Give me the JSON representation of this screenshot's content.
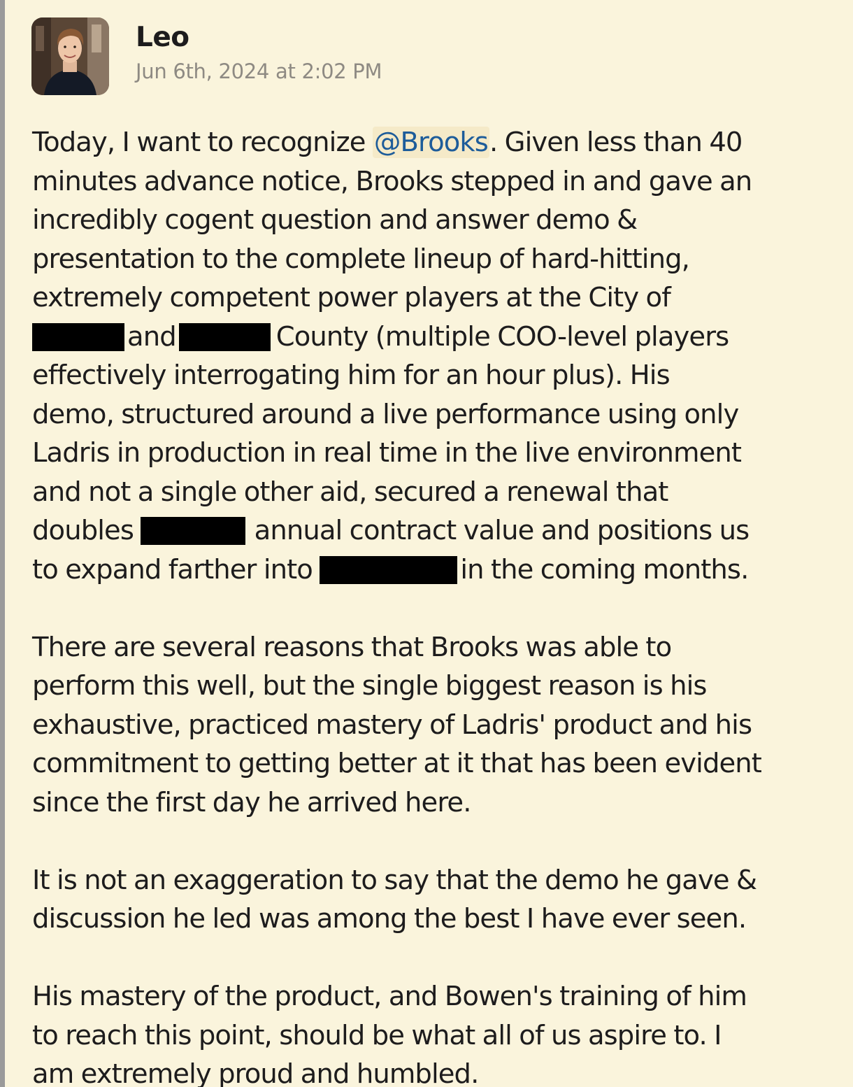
{
  "message": {
    "author": "Leo",
    "timestamp": "Jun 6th, 2024 at 2:02 PM",
    "avatar_icon": "user-avatar-photo",
    "colors": {
      "background": "#faf4dc",
      "mention": "#1d5c9a",
      "timestamp": "#8e8a83"
    },
    "p1": {
      "l1a": "Today, I want to recognize ",
      "mention": "@Brooks",
      "l1b": ". Given less than 40",
      "l2": "minutes advance notice, Brooks stepped in and gave an",
      "l3": "incredibly cogent question and answer demo &",
      "l4": "presentation to the complete lineup of hard-hitting,",
      "l5": "extremely competent power players at the City of",
      "l6a": "and",
      "l6b": "County (multiple COO-level players",
      "l7": "effectively interrogating him for an hour plus). His",
      "l8": "demo, structured around a live performance using only",
      "l9": "Ladris in production in real time in the live environment",
      "l10": "and not a single other aid, secured a renewal that",
      "l11a": "doubles ",
      "l11b": " annual contract value and positions us",
      "l12a": "to expand farther into ",
      "l12b": "in the coming months."
    },
    "p2": {
      "l1": "There are several reasons that Brooks was able to",
      "l2": "perform this well, but the single biggest reason is his",
      "l3": "exhaustive, practiced mastery of Ladris' product and his",
      "l4": "commitment to getting better at it that has been evident",
      "l5": "since the first day he arrived here."
    },
    "p3": {
      "l1": "It is not an exaggeration to say that the demo he gave &",
      "l2": "discussion he led was among the best I have ever seen."
    },
    "p4": {
      "l1": "His mastery of the product, and Bowen's training of him",
      "l2": "to reach this point, should be what all of us aspire to. I",
      "l3": "am extremely proud and humbled."
    }
  }
}
